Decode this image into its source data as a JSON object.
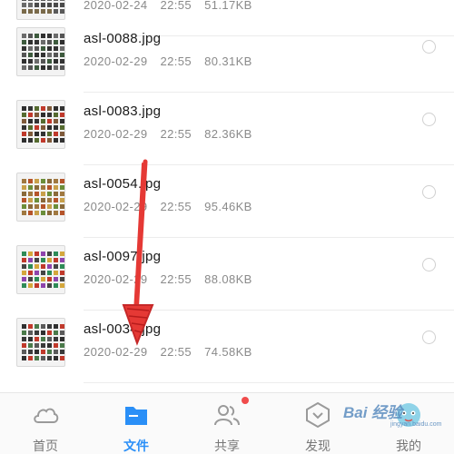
{
  "files": [
    {
      "name": "",
      "date": "2020-02-24",
      "time": "22:55",
      "size": "51.17KB",
      "thumb_palette": [
        "#5a5a5a",
        "#7a6a4a",
        "#4a4a4a",
        "#6a6a6a"
      ]
    },
    {
      "name": "asl-0088.jpg",
      "date": "2020-02-29",
      "time": "22:55",
      "size": "80.31KB",
      "thumb_palette": [
        "#333333",
        "#555555",
        "#2f2f2f",
        "#6b6b6b",
        "#3d5a3d"
      ]
    },
    {
      "name": "asl-0083.jpg",
      "date": "2020-02-29",
      "time": "22:55",
      "size": "82.36KB",
      "thumb_palette": [
        "#c0392b",
        "#2e2e2e",
        "#556b2f",
        "#7f5a3a",
        "#333333"
      ]
    },
    {
      "name": "asl-0054.jpg",
      "date": "2020-02-29",
      "time": "22:55",
      "size": "95.46KB",
      "thumb_palette": [
        "#c8a04a",
        "#8a6a3a",
        "#b5542a",
        "#6b8e3a",
        "#a07840"
      ]
    },
    {
      "name": "asl-0097.jpg",
      "date": "2020-02-29",
      "time": "22:55",
      "size": "88.08KB",
      "thumb_palette": [
        "#d4a73c",
        "#8e44ad",
        "#2e8b57",
        "#c0392b",
        "#444444"
      ]
    },
    {
      "name": "asl-0034.jpg",
      "date": "2020-02-29",
      "time": "22:55",
      "size": "74.58KB",
      "thumb_palette": [
        "#2f2f2f",
        "#4a7a4a",
        "#3a3a3a",
        "#c0392b",
        "#5a5a5a"
      ]
    }
  ],
  "tabs": [
    {
      "label": "首页",
      "icon": "cloud-icon",
      "active": false
    },
    {
      "label": "文件",
      "icon": "folder-icon",
      "active": true
    },
    {
      "label": "共享",
      "icon": "people-icon",
      "active": false,
      "badge": true
    },
    {
      "label": "发现",
      "icon": "discover-icon",
      "active": false
    },
    {
      "label": "我的",
      "icon": "avatar-icon",
      "active": false
    }
  ],
  "colors": {
    "accent": "#2a8ff7",
    "badge": "#f04b4b",
    "annotation_arrow": "#e53935",
    "meta_text": "#8a8a8a"
  },
  "watermark": {
    "text": "Bai 经验",
    "sub": "jingyan.baidu.com"
  }
}
